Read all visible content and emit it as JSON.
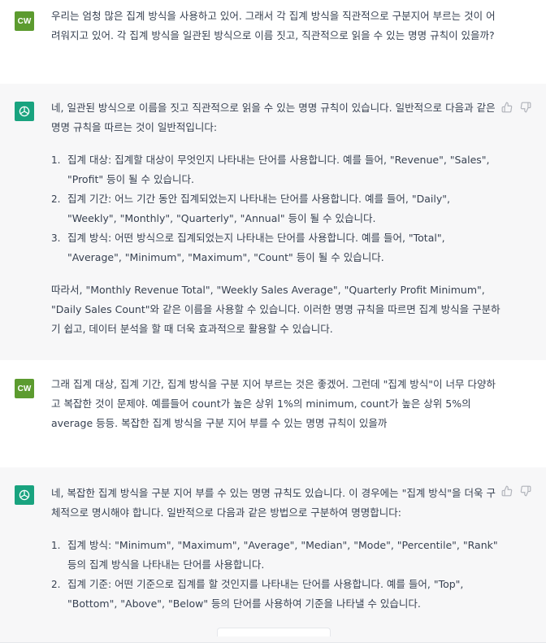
{
  "messages": [
    {
      "role": "user",
      "avatar_text": "CW",
      "text": "우리는 엄청 많은 집계 방식을 사용하고 있어. 그래서 각 집계 방식을 직관적으로 구분지어 부르는 것이 어려워지고 있어. 각 집계 방식을 일관된 방식으로 이름 짓고, 직관적으로 읽을 수 있는 명명 규칙이 있을까?"
    },
    {
      "role": "assistant",
      "avatar_icon": "openai-logo-icon",
      "intro": "네, 일관된 방식으로 이름을 짓고 직관적으로 읽을 수 있는 명명 규칙이 있습니다. 일반적으로 다음과 같은 명명 규칙을 따르는 것이 일반적입니다:",
      "items": [
        {
          "num": "1.",
          "text": "집계 대상: 집계할 대상이 무엇인지 나타내는 단어를 사용합니다. 예를 들어, \"Revenue\", \"Sales\", \"Profit\" 등이 될 수 있습니다."
        },
        {
          "num": "2.",
          "text": "집계 기간: 어느 기간 동안 집계되었는지 나타내는 단어를 사용합니다. 예를 들어, \"Daily\", \"Weekly\", \"Monthly\", \"Quarterly\", \"Annual\" 등이 될 수 있습니다."
        },
        {
          "num": "3.",
          "text": "집계 방식: 어떤 방식으로 집계되었는지 나타내는 단어를 사용합니다. 예를 들어, \"Total\", \"Average\", \"Minimum\", \"Maximum\", \"Count\" 등이 될 수 있습니다."
        }
      ],
      "outro": "따라서, \"Monthly Revenue Total\", \"Weekly Sales Average\", \"Quarterly Profit Minimum\", \"Daily Sales Count\"와 같은 이름을 사용할 수 있습니다. 이러한 명명 규칙을 따르면 집계 방식을 구분하기 쉽고, 데이터 분석을 할 때 더욱 효과적으로 활용할 수 있습니다."
    },
    {
      "role": "user",
      "avatar_text": "CW",
      "text": "그래 집계 대상, 집계 기간, 집계 방식을 구분 지어 부르는 것은 좋겠어. 그런데 \"집계 방식\"이 너무 다양하고 복잡한 것이 문제야. 예를들어 count가 높은 상위 1%의 minimum, count가 높은 상위 5%의 average 등등. 복잡한 집계 방식을 구분 지어 부를 수 있는 명명 규칙이 있을까"
    },
    {
      "role": "assistant",
      "avatar_icon": "openai-logo-icon",
      "intro": "네, 복잡한 집계 방식을 구분 지어 부를 수 있는 명명 규칙도 있습니다. 이 경우에는 \"집계 방식\"을 더욱 구체적으로 명시해야 합니다. 일반적으로 다음과 같은 방법으로 구분하여 명명합니다:",
      "items": [
        {
          "num": "1.",
          "text": "집계 방식: \"Minimum\", \"Maximum\", \"Average\", \"Median\", \"Mode\", \"Percentile\", \"Rank\" 등의 집계 방식을 나타내는 단어를 사용합니다."
        },
        {
          "num": "2.",
          "text": "집계 기준: 어떤 기준으로 집계를 할 것인지를 나타내는 단어를 사용합니다. 예를 들어, \"Top\", \"Bottom\", \"Above\", \"Below\" 등의 단어를 사용하여 기준을 나타낼 수 있습니다."
        }
      ]
    }
  ],
  "feedback_icons": [
    "thumbs-up-icon",
    "thumbs-down-icon"
  ]
}
